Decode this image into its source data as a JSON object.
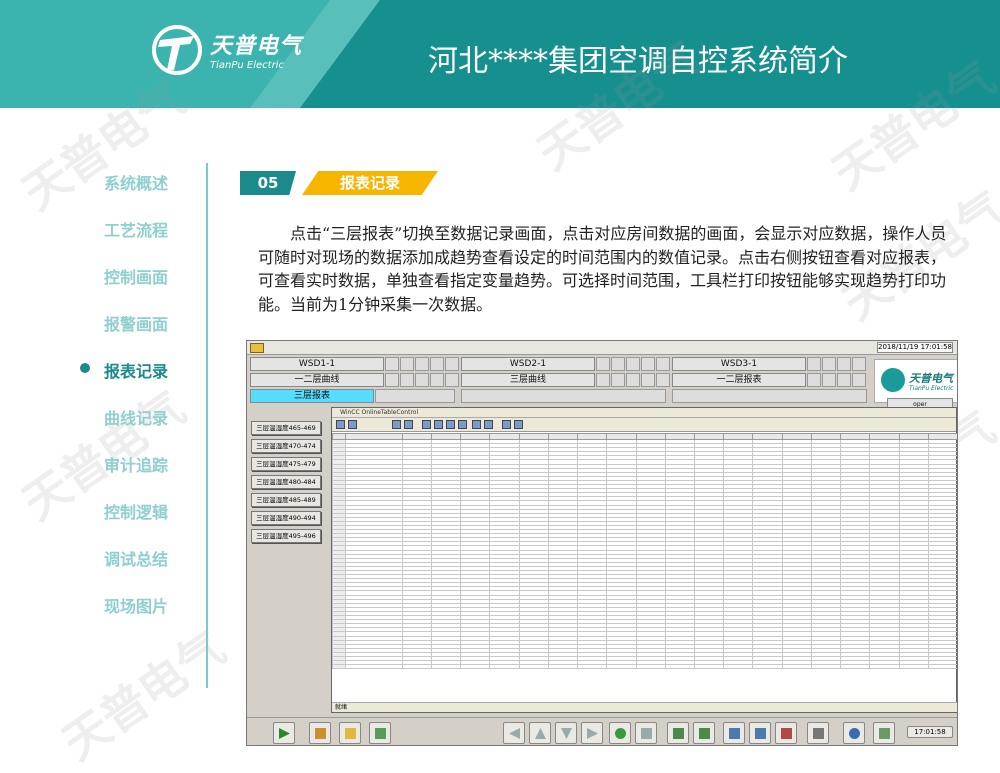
{
  "header": {
    "logo_cn": "天普电气",
    "logo_en": "TianPu Electric",
    "title": "河北****集团空调自控系统简介"
  },
  "watermark": "天普电气",
  "nav": {
    "items": [
      {
        "label": "系统概述",
        "active": false
      },
      {
        "label": "工艺流程",
        "active": false
      },
      {
        "label": "控制画面",
        "active": false
      },
      {
        "label": "报警画面",
        "active": false
      },
      {
        "label": "报表记录",
        "active": true
      },
      {
        "label": "曲线记录",
        "active": false
      },
      {
        "label": "审计追踪",
        "active": false
      },
      {
        "label": "控制逻辑",
        "active": false
      },
      {
        "label": "调试总结",
        "active": false
      },
      {
        "label": "现场图片",
        "active": false
      }
    ]
  },
  "section": {
    "number": "05",
    "title": "报表记录"
  },
  "description": "点击“三层报表”切换至数据记录画面，点击对应房间数据的画面，会显示对应数据，操作人员可随时对现场的数据添加成趋势查看设定的时间范围内的数值记录。点击右侧按钮查看对应报表，可查看实时数据，单独查看指定变量趋势。可选择时间范围，工具栏打印按钮能够实现趋势打印功能。当前为1分钟采集一次数据。",
  "screenshot": {
    "datetime": "2018/11/19 17:01:58",
    "wsd_row1": [
      "WSD1-1",
      "WSD2-1",
      "WSD3-1"
    ],
    "wsd_row2": [
      "一二层曲线",
      "三层曲线",
      "一二层报表"
    ],
    "active_button": "三层报表",
    "logo_cn": "天普电气",
    "logo_en": "TianPu Electric",
    "user": "oper",
    "left_buttons": [
      "三层温湿度465-469",
      "三层温湿度470-474",
      "三层温湿度475-479",
      "三层温湿度480-484",
      "三层温湿度485-489",
      "三层温湿度490-494",
      "三层温湿度495-496"
    ],
    "table_title": "WinCC OnlineTableControl",
    "status": "就绪",
    "clock": "17:01:58"
  }
}
